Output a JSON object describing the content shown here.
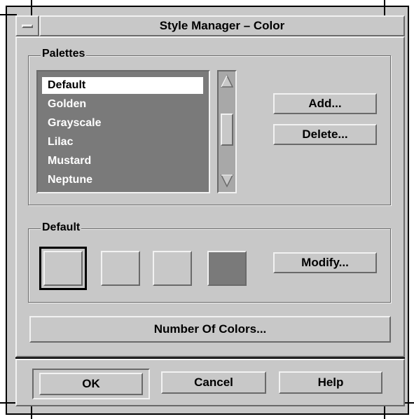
{
  "window": {
    "title": "Style Manager – Color",
    "menu_button_icon": "window-menu-icon"
  },
  "palettes": {
    "group_label": "Palettes",
    "items": [
      "Default",
      "Golden",
      "Grayscale",
      "Lilac",
      "Mustard",
      "Neptune"
    ],
    "selected": "Default",
    "add_label": "Add...",
    "delete_label": "Delete..."
  },
  "palette_colors": {
    "group_label": "Default",
    "swatches": [
      "#c8c8c8",
      "#c8c8c8",
      "#c8c8c8",
      "#7a7a7a"
    ],
    "modify_label": "Modify..."
  },
  "number_of_colors_label": "Number Of Colors...",
  "footer": {
    "ok_label": "OK",
    "cancel_label": "Cancel",
    "help_label": "Help"
  },
  "colors": {
    "surface": "#c8c8c8",
    "list_bg": "#7a7a7a",
    "highlight": "#f2f2f2",
    "shadow": "#6a6a6a"
  }
}
